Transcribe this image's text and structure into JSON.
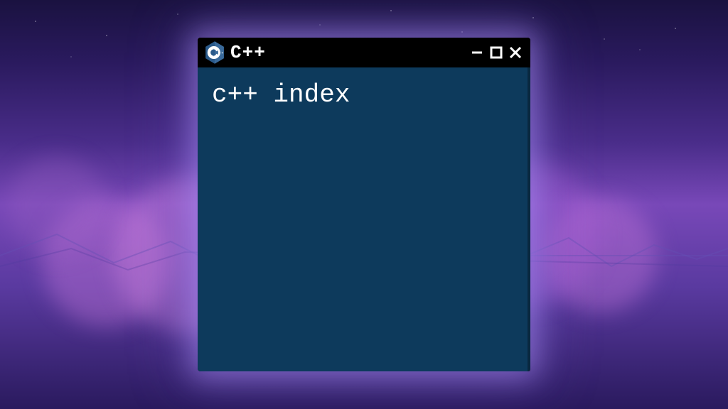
{
  "window": {
    "title": "C++",
    "body_text": "c++ index"
  },
  "icons": {
    "logo": "cpp-logo",
    "minimize": "minimize-icon",
    "maximize": "maximize-icon",
    "close": "close-icon"
  }
}
